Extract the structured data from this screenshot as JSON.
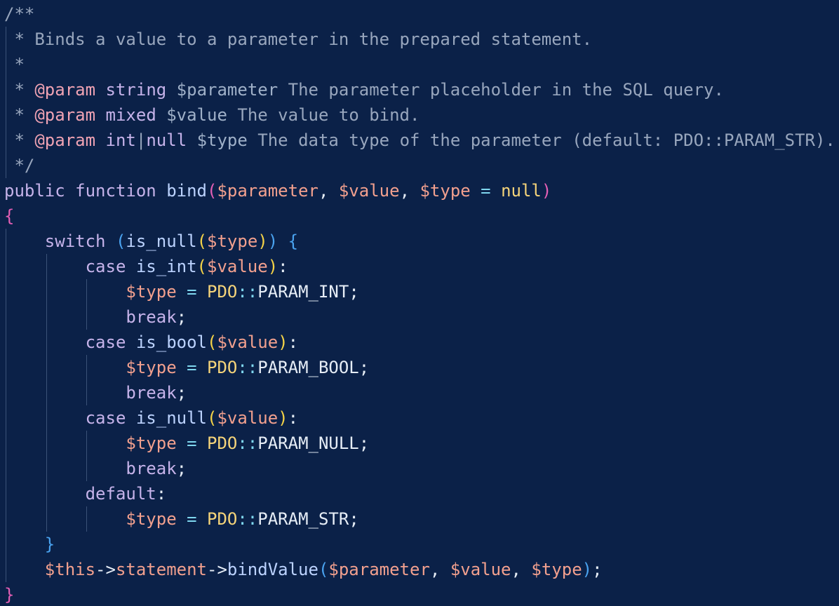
{
  "editor": {
    "language": "php",
    "colors": {
      "background": "#0b2148",
      "comment": "#98a6bd",
      "docTag": "#f0a3b4",
      "docType": "#c6b3ea",
      "docVar": "#9fb0c8",
      "keyword": "#c6b3ea",
      "function": "#bcd3ff",
      "variable": "#f2a08e",
      "operator": "#7fd7ef",
      "constant": "#f5d47a",
      "plain": "#e6edf6",
      "bracketPink": "#e45fb5",
      "bracketYellow": "#f5d347",
      "bracketBlue": "#4aa3f0",
      "indentGuide": "#3b5278"
    },
    "lines": [
      {
        "tokens": [
          {
            "t": "/**",
            "c": "comment"
          }
        ]
      },
      {
        "tokens": [
          {
            "t": " * Binds a value to a parameter in the prepared statement.",
            "c": "comment"
          }
        ]
      },
      {
        "tokens": [
          {
            "t": " *",
            "c": "comment"
          }
        ]
      },
      {
        "tokens": [
          {
            "t": " * ",
            "c": "comment"
          },
          {
            "t": "@param",
            "c": "docTag"
          },
          {
            "t": " ",
            "c": "comment"
          },
          {
            "t": "string",
            "c": "docType"
          },
          {
            "t": " ",
            "c": "comment"
          },
          {
            "t": "$parameter",
            "c": "docVar"
          },
          {
            "t": " The parameter placeholder in the SQL query.",
            "c": "comment"
          }
        ]
      },
      {
        "tokens": [
          {
            "t": " * ",
            "c": "comment"
          },
          {
            "t": "@param",
            "c": "docTag"
          },
          {
            "t": " ",
            "c": "comment"
          },
          {
            "t": "mixed",
            "c": "docType"
          },
          {
            "t": " ",
            "c": "comment"
          },
          {
            "t": "$value",
            "c": "docVar"
          },
          {
            "t": " The value to bind.",
            "c": "comment"
          }
        ]
      },
      {
        "tokens": [
          {
            "t": " * ",
            "c": "comment"
          },
          {
            "t": "@param",
            "c": "docTag"
          },
          {
            "t": " ",
            "c": "comment"
          },
          {
            "t": "int",
            "c": "docType"
          },
          {
            "t": "|",
            "c": "comment"
          },
          {
            "t": "null",
            "c": "docType"
          },
          {
            "t": " ",
            "c": "comment"
          },
          {
            "t": "$type",
            "c": "docVar"
          },
          {
            "t": " The data type of the parameter (default: PDO::PARAM_STR).",
            "c": "comment"
          }
        ]
      },
      {
        "tokens": [
          {
            "t": " */",
            "c": "comment"
          }
        ]
      },
      {
        "tokens": [
          {
            "t": "public",
            "c": "keyword"
          },
          {
            "t": " ",
            "c": "plain"
          },
          {
            "t": "function",
            "c": "keyword"
          },
          {
            "t": " ",
            "c": "plain"
          },
          {
            "t": "bind",
            "c": "function"
          },
          {
            "t": "(",
            "c": "bracketPink"
          },
          {
            "t": "$parameter",
            "c": "variable"
          },
          {
            "t": ", ",
            "c": "plain"
          },
          {
            "t": "$value",
            "c": "variable"
          },
          {
            "t": ", ",
            "c": "plain"
          },
          {
            "t": "$type",
            "c": "variable"
          },
          {
            "t": " ",
            "c": "plain"
          },
          {
            "t": "=",
            "c": "operator"
          },
          {
            "t": " ",
            "c": "plain"
          },
          {
            "t": "null",
            "c": "constant"
          },
          {
            "t": ")",
            "c": "bracketPink"
          }
        ]
      },
      {
        "tokens": [
          {
            "t": "{",
            "c": "bracketPink"
          }
        ]
      },
      {
        "tokens": [
          {
            "t": "    ",
            "c": "plain"
          },
          {
            "t": "switch",
            "c": "keyword"
          },
          {
            "t": " ",
            "c": "plain"
          },
          {
            "t": "(",
            "c": "bracketBlue"
          },
          {
            "t": "is_null",
            "c": "function"
          },
          {
            "t": "(",
            "c": "bracketYellow"
          },
          {
            "t": "$type",
            "c": "variable"
          },
          {
            "t": ")",
            "c": "bracketYellow"
          },
          {
            "t": ")",
            "c": "bracketBlue"
          },
          {
            "t": " ",
            "c": "plain"
          },
          {
            "t": "{",
            "c": "bracketBlue"
          }
        ]
      },
      {
        "tokens": [
          {
            "t": "        ",
            "c": "plain"
          },
          {
            "t": "case",
            "c": "keyword"
          },
          {
            "t": " ",
            "c": "plain"
          },
          {
            "t": "is_int",
            "c": "function"
          },
          {
            "t": "(",
            "c": "bracketYellow"
          },
          {
            "t": "$value",
            "c": "variable"
          },
          {
            "t": ")",
            "c": "bracketYellow"
          },
          {
            "t": ":",
            "c": "plain"
          }
        ]
      },
      {
        "tokens": [
          {
            "t": "            ",
            "c": "plain"
          },
          {
            "t": "$type",
            "c": "variable"
          },
          {
            "t": " ",
            "c": "plain"
          },
          {
            "t": "=",
            "c": "operator"
          },
          {
            "t": " ",
            "c": "plain"
          },
          {
            "t": "PDO",
            "c": "constant"
          },
          {
            "t": "::",
            "c": "operator"
          },
          {
            "t": "PARAM_INT",
            "c": "plain"
          },
          {
            "t": ";",
            "c": "plain"
          }
        ]
      },
      {
        "tokens": [
          {
            "t": "            ",
            "c": "plain"
          },
          {
            "t": "break",
            "c": "keyword"
          },
          {
            "t": ";",
            "c": "plain"
          }
        ]
      },
      {
        "tokens": [
          {
            "t": "        ",
            "c": "plain"
          },
          {
            "t": "case",
            "c": "keyword"
          },
          {
            "t": " ",
            "c": "plain"
          },
          {
            "t": "is_bool",
            "c": "function"
          },
          {
            "t": "(",
            "c": "bracketYellow"
          },
          {
            "t": "$value",
            "c": "variable"
          },
          {
            "t": ")",
            "c": "bracketYellow"
          },
          {
            "t": ":",
            "c": "plain"
          }
        ]
      },
      {
        "tokens": [
          {
            "t": "            ",
            "c": "plain"
          },
          {
            "t": "$type",
            "c": "variable"
          },
          {
            "t": " ",
            "c": "plain"
          },
          {
            "t": "=",
            "c": "operator"
          },
          {
            "t": " ",
            "c": "plain"
          },
          {
            "t": "PDO",
            "c": "constant"
          },
          {
            "t": "::",
            "c": "operator"
          },
          {
            "t": "PARAM_BOOL",
            "c": "plain"
          },
          {
            "t": ";",
            "c": "plain"
          }
        ]
      },
      {
        "tokens": [
          {
            "t": "            ",
            "c": "plain"
          },
          {
            "t": "break",
            "c": "keyword"
          },
          {
            "t": ";",
            "c": "plain"
          }
        ]
      },
      {
        "tokens": [
          {
            "t": "        ",
            "c": "plain"
          },
          {
            "t": "case",
            "c": "keyword"
          },
          {
            "t": " ",
            "c": "plain"
          },
          {
            "t": "is_null",
            "c": "function"
          },
          {
            "t": "(",
            "c": "bracketYellow"
          },
          {
            "t": "$value",
            "c": "variable"
          },
          {
            "t": ")",
            "c": "bracketYellow"
          },
          {
            "t": ":",
            "c": "plain"
          }
        ]
      },
      {
        "tokens": [
          {
            "t": "            ",
            "c": "plain"
          },
          {
            "t": "$type",
            "c": "variable"
          },
          {
            "t": " ",
            "c": "plain"
          },
          {
            "t": "=",
            "c": "operator"
          },
          {
            "t": " ",
            "c": "plain"
          },
          {
            "t": "PDO",
            "c": "constant"
          },
          {
            "t": "::",
            "c": "operator"
          },
          {
            "t": "PARAM_NULL",
            "c": "plain"
          },
          {
            "t": ";",
            "c": "plain"
          }
        ]
      },
      {
        "tokens": [
          {
            "t": "            ",
            "c": "plain"
          },
          {
            "t": "break",
            "c": "keyword"
          },
          {
            "t": ";",
            "c": "plain"
          }
        ]
      },
      {
        "tokens": [
          {
            "t": "        ",
            "c": "plain"
          },
          {
            "t": "default",
            "c": "keyword"
          },
          {
            "t": ":",
            "c": "plain"
          }
        ]
      },
      {
        "tokens": [
          {
            "t": "            ",
            "c": "plain"
          },
          {
            "t": "$type",
            "c": "variable"
          },
          {
            "t": " ",
            "c": "plain"
          },
          {
            "t": "=",
            "c": "operator"
          },
          {
            "t": " ",
            "c": "plain"
          },
          {
            "t": "PDO",
            "c": "constant"
          },
          {
            "t": "::",
            "c": "operator"
          },
          {
            "t": "PARAM_STR",
            "c": "plain"
          },
          {
            "t": ";",
            "c": "plain"
          }
        ]
      },
      {
        "tokens": [
          {
            "t": "    ",
            "c": "plain"
          },
          {
            "t": "}",
            "c": "bracketBlue"
          }
        ]
      },
      {
        "tokens": [
          {
            "t": "    ",
            "c": "plain"
          },
          {
            "t": "$this",
            "c": "variable"
          },
          {
            "t": "->",
            "c": "plain"
          },
          {
            "t": "statement",
            "c": "variable"
          },
          {
            "t": "->",
            "c": "plain"
          },
          {
            "t": "bindValue",
            "c": "function"
          },
          {
            "t": "(",
            "c": "bracketBlue"
          },
          {
            "t": "$parameter",
            "c": "variable"
          },
          {
            "t": ", ",
            "c": "plain"
          },
          {
            "t": "$value",
            "c": "variable"
          },
          {
            "t": ", ",
            "c": "plain"
          },
          {
            "t": "$type",
            "c": "variable"
          },
          {
            "t": ")",
            "c": "bracketBlue"
          },
          {
            "t": ";",
            "c": "plain"
          }
        ]
      },
      {
        "tokens": [
          {
            "t": "}",
            "c": "bracketPink"
          }
        ]
      }
    ]
  }
}
